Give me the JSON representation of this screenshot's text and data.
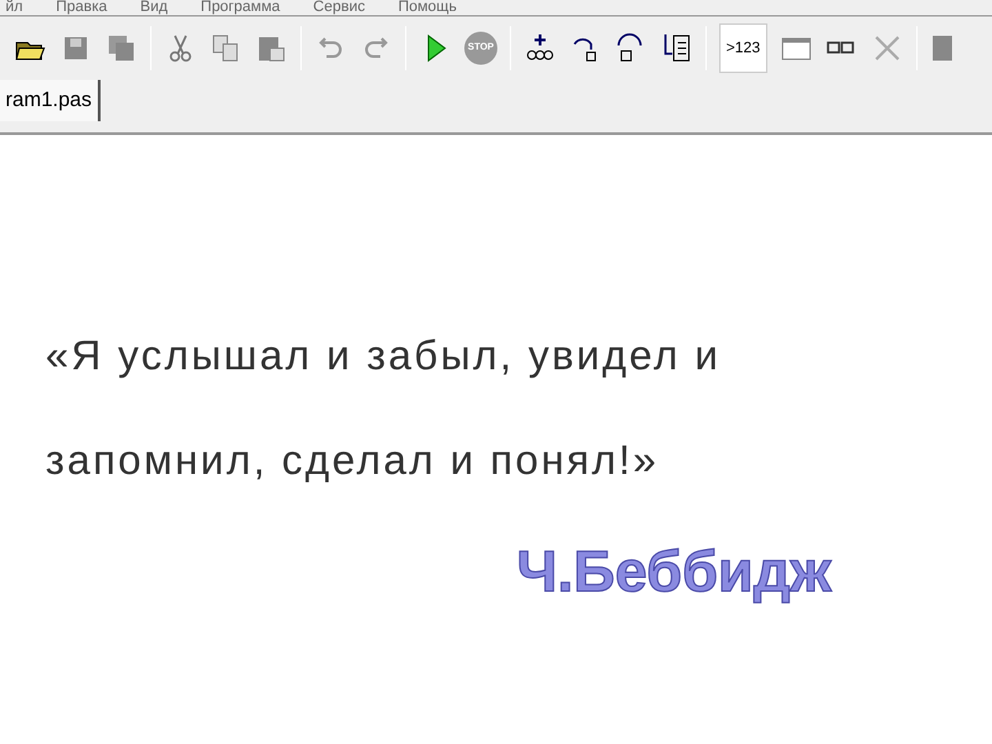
{
  "menu": [
    "йл",
    "Правка",
    "Вид",
    "Программа",
    "Сервис",
    "Помощь"
  ],
  "toolbar": [
    {
      "kind": "open"
    },
    {
      "kind": "save"
    },
    {
      "kind": "saveall"
    },
    {
      "kind": "sep"
    },
    {
      "kind": "cut"
    },
    {
      "kind": "copy"
    },
    {
      "kind": "paste"
    },
    {
      "kind": "sep"
    },
    {
      "kind": "undo"
    },
    {
      "kind": "redo"
    },
    {
      "kind": "sep"
    },
    {
      "kind": "run"
    },
    {
      "kind": "stop",
      "label": "STOP"
    },
    {
      "kind": "sep"
    },
    {
      "kind": "watch"
    },
    {
      "kind": "stepin"
    },
    {
      "kind": "stepover"
    },
    {
      "kind": "gotocursor"
    },
    {
      "kind": "sep"
    },
    {
      "kind": "output",
      "label": ">123",
      "selected": true
    },
    {
      "kind": "window"
    },
    {
      "kind": "watches"
    },
    {
      "kind": "close"
    },
    {
      "kind": "sep"
    },
    {
      "kind": "more"
    }
  ],
  "tabs": [
    {
      "label": "ram1.pas",
      "selected": true
    }
  ],
  "quote": [
    "«Я услышал и забыл, увидел и",
    "запомнил, сделал и понял!»"
  ],
  "author": "Ч.Беббидж"
}
